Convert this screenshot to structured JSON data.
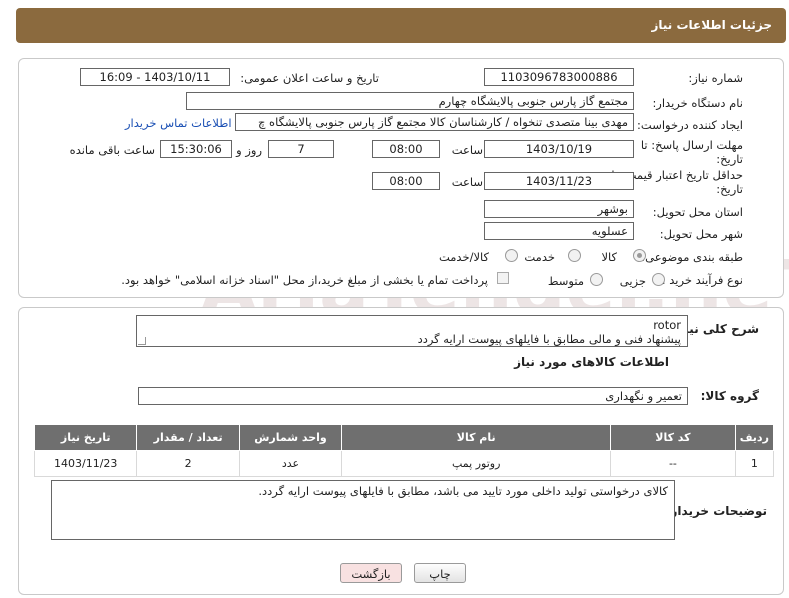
{
  "header": {
    "title": "جزئیات اطلاعات نیاز"
  },
  "form": {
    "need_number_label": "شماره نیاز:",
    "need_number": "1103096783000886",
    "announce_label": "تاریخ و ساعت اعلان عمومی:",
    "announce_value": "1403/10/11 - 16:09",
    "buyer_org_label": "نام دستگاه خریدار:",
    "buyer_org": "مجتمع گاز پارس جنوبی  پالایشگاه چهارم",
    "requester_label": "ایجاد کننده درخواست:",
    "requester": "مهدی بینا متصدی تنخواه / کارشناسان کالا مجتمع گاز پارس جنوبی  پالایشگاه چ",
    "buyer_contact_link": "اطلاعات تماس خریدار",
    "deadline_label": "مهلت ارسال پاسخ: تا تاریخ:",
    "deadline_date": "1403/10/19",
    "time_label": "ساعت",
    "deadline_time": "08:00",
    "days_value": "7",
    "days_label": "روز و",
    "remaining_time": "15:30:06",
    "remaining_label": "ساعت باقی مانده",
    "validity_label": "حداقل تاریخ اعتبار قیمت: تا تاریخ:",
    "validity_date": "1403/11/23",
    "validity_time": "08:00",
    "province_label": "استان محل تحویل:",
    "province": "بوشهر",
    "city_label": "شهر محل تحویل:",
    "city": "عسلویه",
    "category_label": "طبقه بندی موضوعی:",
    "category_options": [
      "کالا",
      "خدمت",
      "کالا/خدمت"
    ],
    "category_selected": "کالا",
    "process_label": "نوع فرآیند خرید :",
    "process_options": [
      "جزیی",
      "متوسط"
    ],
    "payment_note": "پرداخت تمام یا بخشی از مبلغ خرید،از محل \"اسناد خزانه اسلامی\" خواهد بود."
  },
  "general": {
    "desc_label": "شرح کلی نیاز:",
    "desc_line1": "rotor",
    "desc_line2": "پیشنهاد فنی و مالی مطابق با فایلهای پیوست ارایه گردد",
    "goods_info_title": "اطلاعات کالاهای مورد نیاز",
    "goods_group_label": "گروه کالا:",
    "goods_group": "تعمیر و نگهداری"
  },
  "table": {
    "headers": [
      "ردیف",
      "کد کالا",
      "نام کالا",
      "واحد شمارش",
      "تعداد / مقدار",
      "تاریخ نیاز"
    ],
    "rows": [
      [
        "1",
        "--",
        "روتور پمپ",
        "عدد",
        "2",
        "1403/11/23"
      ]
    ]
  },
  "buyer_notes": {
    "label": "توضیحات خریدار:",
    "text": "کالای درخواستی تولید داخلی مورد تایید می باشد، مطابق با فایلهای پیوست ارایه گردد."
  },
  "buttons": {
    "print": "چاپ",
    "back": "بازگشت"
  },
  "watermark": "AriaTender.neT",
  "colors": {
    "header_bg": "#8b6a3e",
    "table_header_bg": "#6f6f6f",
    "link": "#1a4fb4",
    "back_button_bg": "#f8e1e1"
  }
}
